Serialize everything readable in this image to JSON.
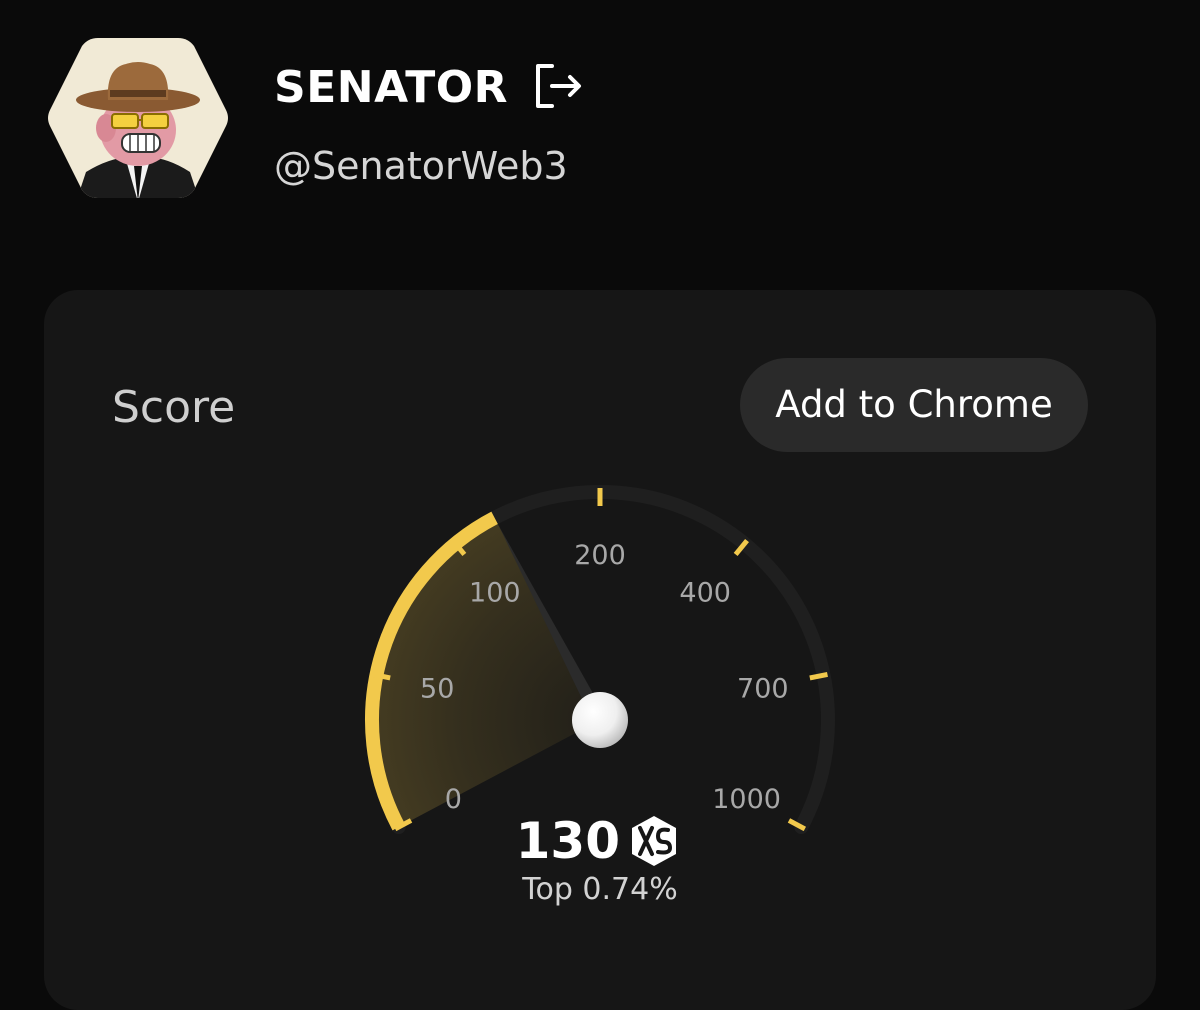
{
  "profile": {
    "name": "SENATOR",
    "handle": "@SenatorWeb3",
    "avatar_icon": "ape-cowboy-avatar",
    "logout_icon": "logout-icon"
  },
  "score_card": {
    "title": "Score",
    "add_button_label": "Add to Chrome"
  },
  "gauge": {
    "tick_labels": [
      "0",
      "50",
      "100",
      "200",
      "400",
      "700",
      "1000"
    ],
    "score": "130",
    "score_numeric": 130,
    "unit_icon": "xs-logo-icon",
    "rank_text": "Top 0.74%"
  },
  "colors": {
    "accent": "#f2c94c",
    "track": "#1f1f1f",
    "card_bg": "#161616",
    "page_bg": "#0a0a0a"
  }
}
